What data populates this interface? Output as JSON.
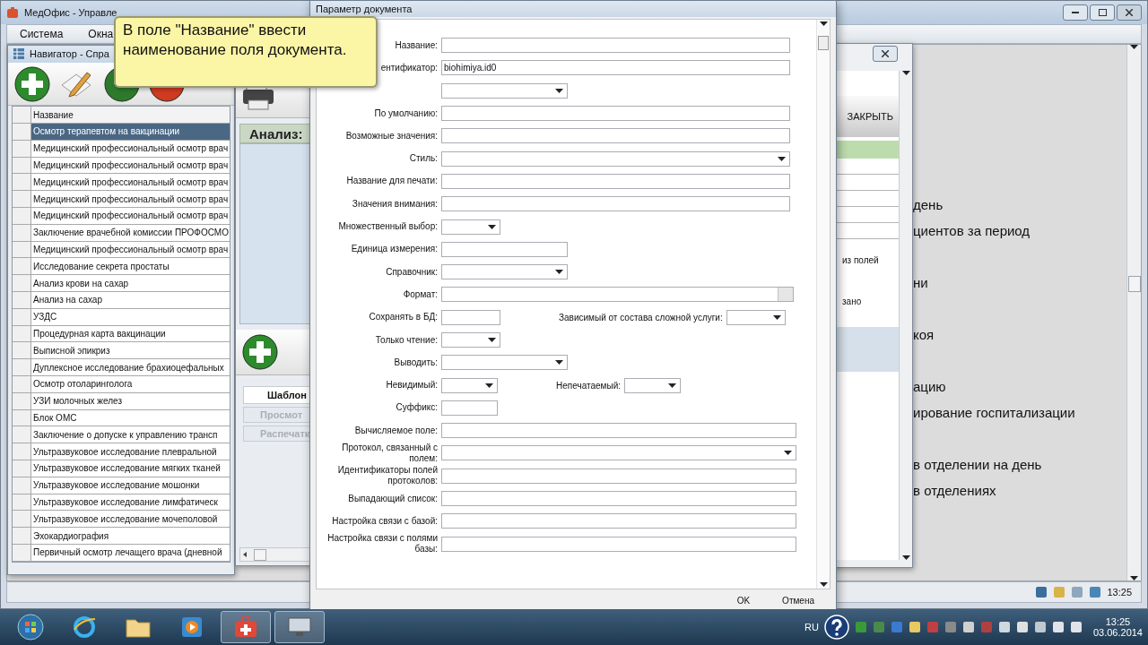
{
  "main_window": {
    "title": "МедОфис - Управле",
    "menu": [
      "Система",
      "Окна"
    ],
    "background_texts": [
      "день",
      "циентов за период",
      "ни",
      "коя",
      "ацию",
      "ирование госпитализации",
      "в отделении на день",
      "в отделениях"
    ],
    "status_time": "13:25"
  },
  "navigator": {
    "title": "Навигатор - Спра",
    "column": "Название",
    "rows": [
      {
        "name": "Осмотр терапевтом на вакцинации",
        "selected": true
      },
      {
        "name": "Медицинский профессиональный осмотр врач",
        "selected": false
      },
      {
        "name": "Медицинский профессиональный осмотр врач",
        "selected": false
      },
      {
        "name": "Медицинский профессиональный осмотр врач",
        "selected": false
      },
      {
        "name": "Медицинский профессиональный осмотр врач",
        "selected": false
      },
      {
        "name": "Медицинский профессиональный осмотр врач",
        "selected": false
      },
      {
        "name": "Заключение врачебной комиссии ПРОФОСМО",
        "selected": false
      },
      {
        "name": "Медицинский профессиональный осмотр врач",
        "selected": false
      },
      {
        "name": "Исследование секрета простаты",
        "selected": false
      },
      {
        "name": "Анализ крови на сахар",
        "selected": false
      },
      {
        "name": "Анализ на сахар",
        "selected": false
      },
      {
        "name": "УЗДС",
        "selected": false
      },
      {
        "name": "Процедурная карта вакцинации",
        "selected": false
      },
      {
        "name": "Выписной эпикриз",
        "selected": false
      },
      {
        "name": "Дуплексное исследование брахиоцефальных",
        "selected": false
      },
      {
        "name": "Осмотр отоларинголога",
        "selected": false
      },
      {
        "name": "УЗИ молочных желез",
        "selected": false
      },
      {
        "name": "Блок ОМС",
        "selected": false
      },
      {
        "name": "Заключение о допуске к управлению трансп",
        "selected": false
      },
      {
        "name": "Ультразвуковое исследование плевральной",
        "selected": false
      },
      {
        "name": "Ультразвуковое исследование мягких тканей",
        "selected": false
      },
      {
        "name": "Ультразвуковое исследование мошонки",
        "selected": false
      },
      {
        "name": "Ультразвуковое исследование лимфатическ",
        "selected": false
      },
      {
        "name": "Ультразвуковое исследование мочеполовой",
        "selected": false
      },
      {
        "name": "Эхокардиография",
        "selected": false
      },
      {
        "name": "Первичный осмотр лечащего врача (дневной",
        "selected": false
      }
    ]
  },
  "analysis_window": {
    "header": "Анализ:",
    "tabs": [
      {
        "label": "Шаблон",
        "selected": true
      }
    ],
    "buttons": [
      {
        "label": "Просмот",
        "disabled": true
      },
      {
        "label": "Распечатк",
        "disabled": true
      }
    ]
  },
  "right_window": {
    "button": "ЗАКРЫТЬ",
    "texts": [
      "из полей",
      "зано"
    ]
  },
  "dialog": {
    "title": "Параметр документа",
    "fields": [
      {
        "label": "Название:",
        "kind": "text"
      },
      {
        "label": "ентификатор:",
        "kind": "text",
        "value": "biohimiya.id0"
      },
      {
        "kind": "select"
      },
      {
        "label": "По умолчанию:",
        "kind": "text"
      },
      {
        "label": "Возможные значения:",
        "kind": "text"
      },
      {
        "label": "Стиль:",
        "kind": "select"
      },
      {
        "label": "Название для печати:",
        "kind": "text"
      },
      {
        "label": "Значения внимания:",
        "kind": "text"
      },
      {
        "label": "Множественный выбор:",
        "kind": "select"
      },
      {
        "label": "Единица измерения:",
        "kind": "text"
      },
      {
        "label": "Справочник:",
        "kind": "select"
      },
      {
        "label": "Формат:",
        "kind": "picker"
      },
      {
        "label": "Сохранять в БД:",
        "kind": "text",
        "extra": {
          "label": "Зависимый от состава сложной услуги:",
          "kind": "select"
        }
      },
      {
        "label": "Только чтение:",
        "kind": "select"
      },
      {
        "label": "Выводить:",
        "kind": "select"
      },
      {
        "label": "Невидимый:",
        "kind": "select",
        "extra": {
          "label": "Непечатаемый:",
          "kind": "select"
        }
      },
      {
        "label": "Суффикс:",
        "kind": "text"
      },
      {
        "label": "Вычисляемое поле:",
        "kind": "text"
      },
      {
        "label": "Протокол, связанный с полем:",
        "kind": "select"
      },
      {
        "label": "Идентификаторы полей протоколов:",
        "kind": "text"
      },
      {
        "label": "Выпадающий список:",
        "kind": "text"
      },
      {
        "label": "Настройка связи с базой:",
        "kind": "text"
      },
      {
        "label": "Настройка связи с полями базы:",
        "kind": "text"
      }
    ],
    "buttons": [
      "OK",
      "Отмена"
    ]
  },
  "tooltip": {
    "text": "В поле \"Название\" ввести наименование поля документа."
  },
  "taskbar": {
    "language": "RU",
    "time": "13:25",
    "date": "03.06.2014"
  }
}
